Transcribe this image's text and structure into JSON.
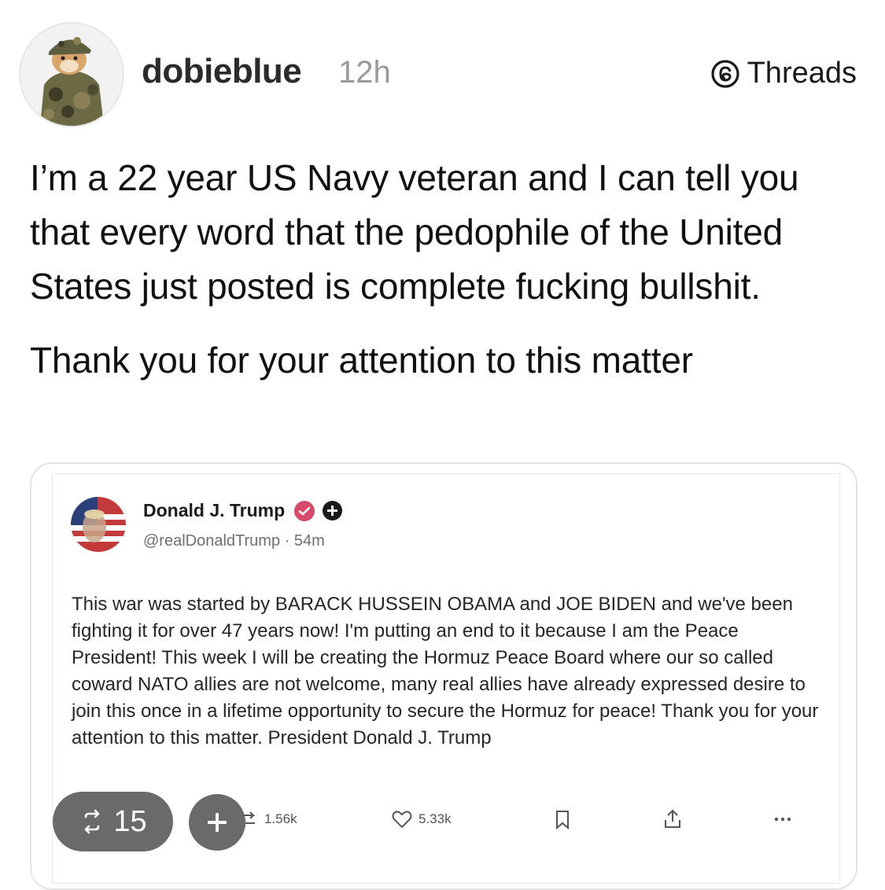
{
  "author": {
    "username": "dobieblue",
    "time_ago": "12h",
    "avatar_icon": "military-dog-avatar-icon"
  },
  "platform_badge": {
    "label": "Threads",
    "icon": "threads-logo-icon"
  },
  "post": {
    "paragraph_1": "I’m a 22 year US Navy veteran and I can tell you that every word that the pedophile of the United States just posted is complete fucking bullshit.",
    "paragraph_2": "Thank you for your attention to this matter"
  },
  "embedded_post": {
    "author_name": "Donald J. Trump",
    "handle_time": "@realDonaldTrump · 54m",
    "body": "This war was started by BARACK HUSSEIN OBAMA and JOE BIDEN and we've been fighting it for over 47 years now! I'm putting an end to it because I am the Peace President! This week I will be creating the Hormuz Peace Board where our so called coward NATO allies are not welcome, many real allies have already expressed desire to join this once in a lifetime opportunity to secure the Hormuz for peace! Thank you for your attention to this matter. President Donald J. Trump",
    "actions": {
      "retruths": "1.56k",
      "likes": "5.33k"
    }
  },
  "reshare_count": "15",
  "colors": {
    "verified_badge": "#d84a6a",
    "pill_background": "#6a6a6a",
    "username_text": "#2b2b2b",
    "time_text": "#9a9a9a"
  }
}
